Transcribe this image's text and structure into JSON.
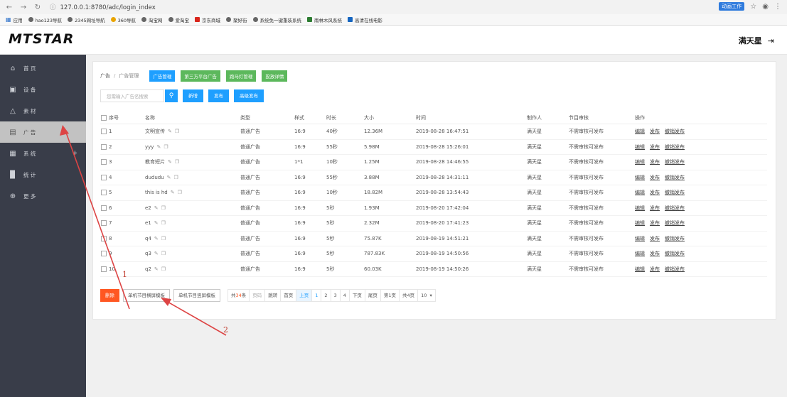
{
  "browser": {
    "url": "127.0.0.1:8780/adc/login_index",
    "bookmarks": [
      "应用",
      "hao123导航",
      "2345网址导航",
      "360导航",
      "淘宝网",
      "爱淘宝",
      "京东商城",
      "聚好街",
      "系统免一键重装系统",
      "雨林木风系统",
      "高清在线电影"
    ],
    "ext_badge": "动画工作"
  },
  "app": {
    "logo": "MTSTAR",
    "user": "满天星",
    "logout_icon": "logout-icon"
  },
  "sidebar": {
    "items": [
      {
        "label": "首 页",
        "icon": "home-icon"
      },
      {
        "label": "设 备",
        "icon": "device-icon"
      },
      {
        "label": "素 材",
        "icon": "material-icon"
      },
      {
        "label": "广 告",
        "icon": "ad-icon",
        "active": true
      },
      {
        "label": "系 统",
        "icon": "system-icon",
        "plus": "+"
      },
      {
        "label": "统 计",
        "icon": "chart-icon"
      },
      {
        "label": "更 多",
        "icon": "more-icon"
      }
    ]
  },
  "breadcrumb": {
    "root": "广告",
    "sep": "/",
    "current": "广告管理",
    "tabs": [
      "广告管理",
      "第三方平台广告",
      "跑马灯管理",
      "投放详情"
    ]
  },
  "toolbar": {
    "search_placeholder": "您需输入广告名搜索",
    "search_icon": "search-icon",
    "add": "新增",
    "publish": "发布",
    "advanced_publish": "高级发布"
  },
  "table": {
    "headers": [
      "序号",
      "名称",
      "类型",
      "样式",
      "时长",
      "大小",
      "时间",
      "制作人",
      "节目审核",
      "操作"
    ],
    "rows": [
      {
        "no": "1",
        "name": "文明宣传",
        "type": "普通广告",
        "style": "16:9",
        "dur": "40秒",
        "size": "12.36M",
        "time": "2019-08-28 16:47:51",
        "maker": "满天星",
        "audit": "不需审核可发布"
      },
      {
        "no": "2",
        "name": "yyy",
        "type": "普通广告",
        "style": "16:9",
        "dur": "55秒",
        "size": "5.98M",
        "time": "2019-08-28 15:26:01",
        "maker": "满天星",
        "audit": "不需审核可发布"
      },
      {
        "no": "3",
        "name": "教育短片",
        "type": "普通广告",
        "style": "1*1",
        "dur": "10秒",
        "size": "1.25M",
        "time": "2019-08-28 14:46:55",
        "maker": "满天星",
        "audit": "不需审核可发布"
      },
      {
        "no": "4",
        "name": "dududu",
        "type": "普通广告",
        "style": "16:9",
        "dur": "55秒",
        "size": "3.88M",
        "time": "2019-08-28 14:31:11",
        "maker": "满天星",
        "audit": "不需审核可发布"
      },
      {
        "no": "5",
        "name": "this is hd",
        "type": "普通广告",
        "style": "16:9",
        "dur": "10秒",
        "size": "18.82M",
        "time": "2019-08-28 13:54:43",
        "maker": "满天星",
        "audit": "不需审核可发布"
      },
      {
        "no": "6",
        "name": "e2",
        "type": "普通广告",
        "style": "16:9",
        "dur": "5秒",
        "size": "1.93M",
        "time": "2019-08-20 17:42:04",
        "maker": "满天星",
        "audit": "不需审核可发布"
      },
      {
        "no": "7",
        "name": "e1",
        "type": "普通广告",
        "style": "16:9",
        "dur": "5秒",
        "size": "2.32M",
        "time": "2019-08-20 17:41:23",
        "maker": "满天星",
        "audit": "不需审核可发布"
      },
      {
        "no": "8",
        "name": "q4",
        "type": "普通广告",
        "style": "16:9",
        "dur": "5秒",
        "size": "75.87K",
        "time": "2019-08-19 14:51:21",
        "maker": "满天星",
        "audit": "不需审核可发布"
      },
      {
        "no": "9",
        "name": "q3",
        "type": "普通广告",
        "style": "16:9",
        "dur": "5秒",
        "size": "787.83K",
        "time": "2019-08-19 14:50:56",
        "maker": "满天星",
        "audit": "不需审核可发布"
      },
      {
        "no": "10",
        "name": "q2",
        "type": "普通广告",
        "style": "16:9",
        "dur": "5秒",
        "size": "60.03K",
        "time": "2019-08-19 14:50:26",
        "maker": "满天星",
        "audit": "不需审核可发布"
      }
    ],
    "ops": [
      "编辑",
      "发布",
      "撤销发布"
    ]
  },
  "footer": {
    "delete": "删除",
    "btn_tpl1": "单机节目横屏模板",
    "btn_tpl2": "单机节目竖屏模板",
    "pager": {
      "total_prefix": "共",
      "total": "34",
      "total_suffix": "条",
      "page_label": "页码",
      "jump": "跳转",
      "first": "首页",
      "prev": "上页",
      "pages": [
        "1",
        "2",
        "3",
        "4"
      ],
      "next": "下页",
      "last": "尾页",
      "current_page": "第1页",
      "total_pages": "共4页",
      "size": "10"
    }
  },
  "annotations": [
    "1",
    "2"
  ],
  "colors": {
    "sidebar": "#393d49",
    "primary": "#1e9fff",
    "green": "#5cb85c",
    "danger": "#ff5722",
    "annotation": "#c0392b"
  }
}
